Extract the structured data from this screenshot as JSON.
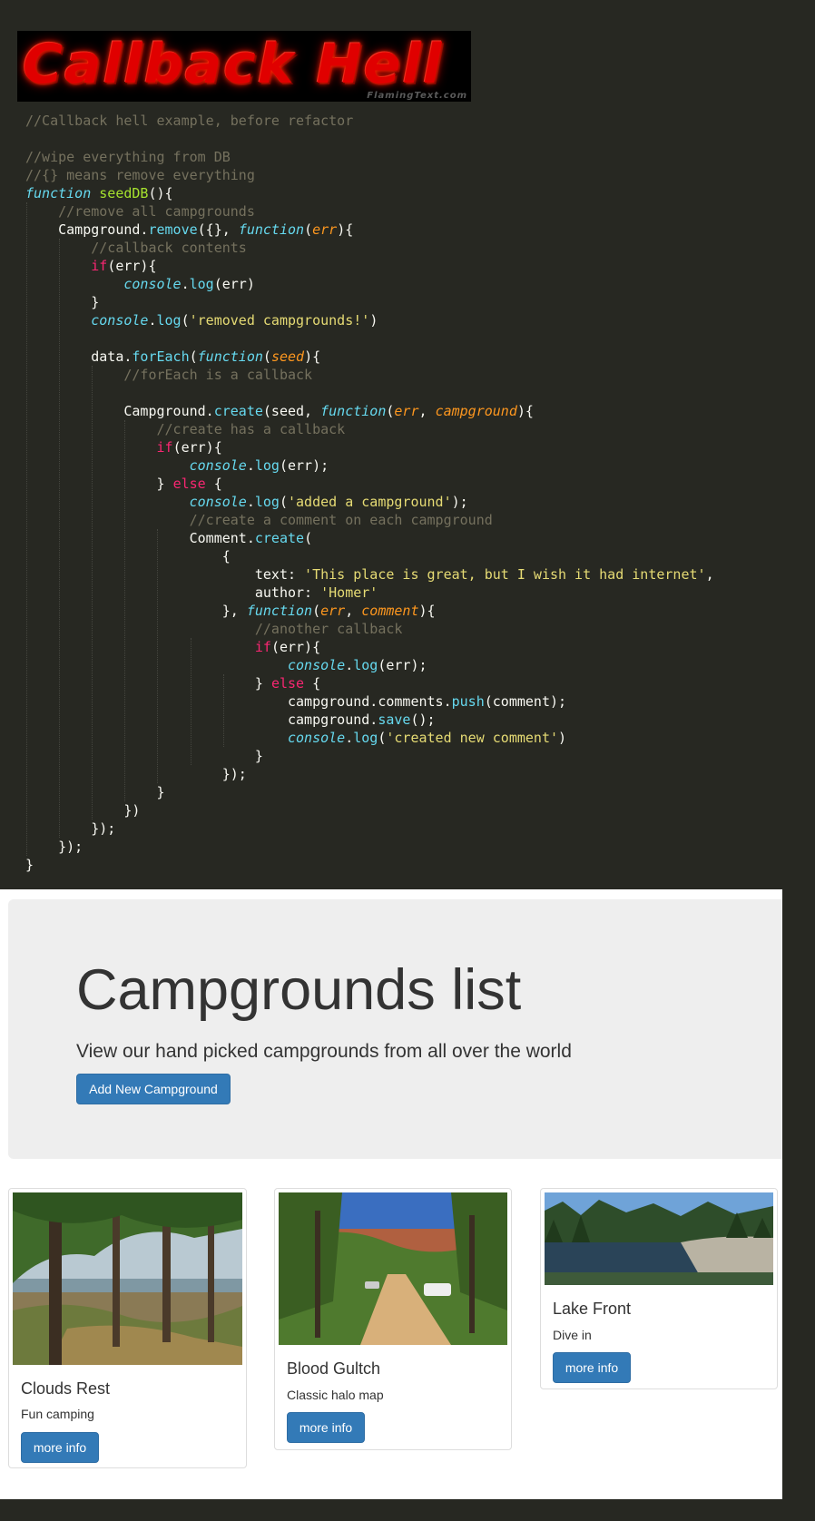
{
  "logo": {
    "text": "Callback Hell",
    "credit": "FlamingText.com"
  },
  "code": {
    "lines": [
      [
        [
          "c-comment",
          "//Callback hell example, before refactor"
        ]
      ],
      [],
      [
        [
          "c-comment",
          "//wipe everything from DB"
        ]
      ],
      [
        [
          "c-comment",
          "//{} means remove everything"
        ]
      ],
      [
        [
          "c-stor",
          "function"
        ],
        [
          "c-plain",
          " "
        ],
        [
          "c-fn",
          "seedDB"
        ],
        [
          "c-plain",
          "(){"
        ]
      ],
      [
        [
          "c-plain",
          "    "
        ],
        [
          "c-comment",
          "//remove all campgrounds"
        ]
      ],
      [
        [
          "c-plain",
          "    Campground."
        ],
        [
          "c-method",
          "remove"
        ],
        [
          "c-plain",
          "({}, "
        ],
        [
          "c-stor",
          "function"
        ],
        [
          "c-plain",
          "("
        ],
        [
          "c-param",
          "err"
        ],
        [
          "c-plain",
          "){"
        ]
      ],
      [
        [
          "c-plain",
          "        "
        ],
        [
          "c-comment",
          "//callback contents"
        ]
      ],
      [
        [
          "c-plain",
          "        "
        ],
        [
          "c-kw",
          "if"
        ],
        [
          "c-plain",
          "(err){"
        ]
      ],
      [
        [
          "c-plain",
          "            "
        ],
        [
          "c-stor",
          "console"
        ],
        [
          "c-plain",
          "."
        ],
        [
          "c-method",
          "log"
        ],
        [
          "c-plain",
          "(err)"
        ]
      ],
      [
        [
          "c-plain",
          "        }"
        ]
      ],
      [
        [
          "c-plain",
          "        "
        ],
        [
          "c-stor",
          "console"
        ],
        [
          "c-plain",
          "."
        ],
        [
          "c-method",
          "log"
        ],
        [
          "c-plain",
          "("
        ],
        [
          "c-str",
          "'removed campgrounds!'"
        ],
        [
          "c-plain",
          ")"
        ]
      ],
      [],
      [
        [
          "c-plain",
          "        data."
        ],
        [
          "c-method",
          "forEach"
        ],
        [
          "c-plain",
          "("
        ],
        [
          "c-stor",
          "function"
        ],
        [
          "c-plain",
          "("
        ],
        [
          "c-param",
          "seed"
        ],
        [
          "c-plain",
          "){"
        ]
      ],
      [
        [
          "c-plain",
          "            "
        ],
        [
          "c-comment",
          "//forEach is a callback"
        ]
      ],
      [],
      [
        [
          "c-plain",
          "            Campground."
        ],
        [
          "c-method",
          "create"
        ],
        [
          "c-plain",
          "(seed, "
        ],
        [
          "c-stor",
          "function"
        ],
        [
          "c-plain",
          "("
        ],
        [
          "c-param",
          "err"
        ],
        [
          "c-plain",
          ", "
        ],
        [
          "c-param",
          "campground"
        ],
        [
          "c-plain",
          "){"
        ]
      ],
      [
        [
          "c-plain",
          "                "
        ],
        [
          "c-comment",
          "//create has a callback"
        ]
      ],
      [
        [
          "c-plain",
          "                "
        ],
        [
          "c-kw",
          "if"
        ],
        [
          "c-plain",
          "(err){"
        ]
      ],
      [
        [
          "c-plain",
          "                    "
        ],
        [
          "c-stor",
          "console"
        ],
        [
          "c-plain",
          "."
        ],
        [
          "c-method",
          "log"
        ],
        [
          "c-plain",
          "(err);"
        ]
      ],
      [
        [
          "c-plain",
          "                } "
        ],
        [
          "c-kw",
          "else"
        ],
        [
          "c-plain",
          " {"
        ]
      ],
      [
        [
          "c-plain",
          "                    "
        ],
        [
          "c-stor",
          "console"
        ],
        [
          "c-plain",
          "."
        ],
        [
          "c-method",
          "log"
        ],
        [
          "c-plain",
          "("
        ],
        [
          "c-str",
          "'added a campground'"
        ],
        [
          "c-plain",
          ");"
        ]
      ],
      [
        [
          "c-plain",
          "                    "
        ],
        [
          "c-comment",
          "//create a comment on each campground"
        ]
      ],
      [
        [
          "c-plain",
          "                    Comment."
        ],
        [
          "c-method",
          "create"
        ],
        [
          "c-plain",
          "("
        ]
      ],
      [
        [
          "c-plain",
          "                        {"
        ]
      ],
      [
        [
          "c-plain",
          "                            text: "
        ],
        [
          "c-str",
          "'This place is great, but I wish it had internet'"
        ],
        [
          "c-plain",
          ","
        ]
      ],
      [
        [
          "c-plain",
          "                            author: "
        ],
        [
          "c-str",
          "'Homer'"
        ]
      ],
      [
        [
          "c-plain",
          "                        }, "
        ],
        [
          "c-stor",
          "function"
        ],
        [
          "c-plain",
          "("
        ],
        [
          "c-param",
          "err"
        ],
        [
          "c-plain",
          ", "
        ],
        [
          "c-param",
          "comment"
        ],
        [
          "c-plain",
          "){"
        ]
      ],
      [
        [
          "c-plain",
          "                            "
        ],
        [
          "c-comment",
          "//another callback"
        ]
      ],
      [
        [
          "c-plain",
          "                            "
        ],
        [
          "c-kw",
          "if"
        ],
        [
          "c-plain",
          "(err){"
        ]
      ],
      [
        [
          "c-plain",
          "                                "
        ],
        [
          "c-stor",
          "console"
        ],
        [
          "c-plain",
          "."
        ],
        [
          "c-method",
          "log"
        ],
        [
          "c-plain",
          "(err);"
        ]
      ],
      [
        [
          "c-plain",
          "                            } "
        ],
        [
          "c-kw",
          "else"
        ],
        [
          "c-plain",
          " {"
        ]
      ],
      [
        [
          "c-plain",
          "                                campground.comments."
        ],
        [
          "c-method",
          "push"
        ],
        [
          "c-plain",
          "(comment);"
        ]
      ],
      [
        [
          "c-plain",
          "                                campground."
        ],
        [
          "c-method",
          "save"
        ],
        [
          "c-plain",
          "();"
        ]
      ],
      [
        [
          "c-plain",
          "                                "
        ],
        [
          "c-stor",
          "console"
        ],
        [
          "c-plain",
          "."
        ],
        [
          "c-method",
          "log"
        ],
        [
          "c-plain",
          "("
        ],
        [
          "c-str",
          "'created new comment'"
        ],
        [
          "c-plain",
          ")"
        ]
      ],
      [
        [
          "c-plain",
          "                            }"
        ]
      ],
      [
        [
          "c-plain",
          "                        });"
        ]
      ],
      [
        [
          "c-plain",
          "                }"
        ]
      ],
      [
        [
          "c-plain",
          "            })"
        ]
      ],
      [
        [
          "c-plain",
          "        });"
        ]
      ],
      [
        [
          "c-plain",
          "    });"
        ]
      ],
      [
        [
          "c-plain",
          "}"
        ]
      ]
    ]
  },
  "jumbotron": {
    "title": "Campgrounds list",
    "subtitle": "View our hand picked campgrounds from all over the world",
    "add_button": "Add New Campground"
  },
  "campgrounds": [
    {
      "name": "Clouds Rest",
      "description": "Fun camping",
      "button": "more info",
      "image": "pine-forest-lake-photo"
    },
    {
      "name": "Blood Gultch",
      "description": "Classic halo map",
      "button": "more info",
      "image": "canyon-road-photo"
    },
    {
      "name": "Lake Front",
      "description": "Dive in",
      "button": "more info",
      "image": "mountain-lake-photo"
    }
  ],
  "colors": {
    "editor_bg": "#272822",
    "primary_button": "#337ab7",
    "jumbotron_bg": "#eeeeee"
  }
}
